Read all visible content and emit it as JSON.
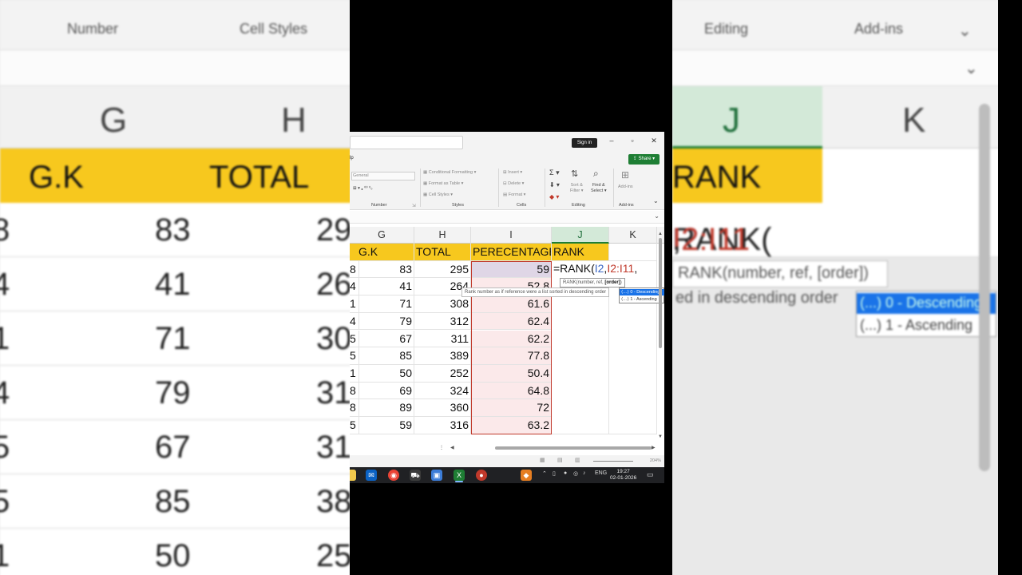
{
  "ribbon": {
    "number_label": "Number",
    "styles_label": "Styles",
    "cells_label": "Cells",
    "editing_label": "Editing",
    "addins_label": "Add-ins",
    "cell_styles": "Cell Styles",
    "conditional_formatting": "Conditional Formatting",
    "format_as_table": "Format as Table",
    "insert": "Insert",
    "delete": "Delete",
    "format": "Format",
    "general": "General",
    "sort_filter": "Sort & Filter",
    "find_select": "Find & Select",
    "addins_btn": "Add-ins",
    "help_tab": "lp",
    "sign_in": "Sign in",
    "share": "Share"
  },
  "columns": [
    "G",
    "H",
    "I",
    "J",
    "K"
  ],
  "zoom_columns": [
    "G",
    "H",
    "J",
    "K"
  ],
  "headers": {
    "g": "G.K",
    "h": "TOTAL",
    "i": "PERECENTAGE",
    "j": "RANK"
  },
  "rows": [
    {
      "f": "8",
      "g": "83",
      "h": "295",
      "i": "59"
    },
    {
      "f": "4",
      "g": "41",
      "h": "264",
      "i": "52.8"
    },
    {
      "f": "1",
      "g": "71",
      "h": "308",
      "i": "61.6"
    },
    {
      "f": "4",
      "g": "79",
      "h": "312",
      "i": "62.4"
    },
    {
      "f": "5",
      "g": "67",
      "h": "311",
      "i": "62.2"
    },
    {
      "f": "5",
      "g": "85",
      "h": "389",
      "i": "77.8"
    },
    {
      "f": "1",
      "g": "50",
      "h": "252",
      "i": "50.4"
    },
    {
      "f": "8",
      "g": "69",
      "h": "324",
      "i": "64.8"
    },
    {
      "f": "8",
      "g": "89",
      "h": "360",
      "i": "72"
    },
    {
      "f": "5",
      "g": "59",
      "h": "316",
      "i": "63.2"
    }
  ],
  "zoom_rows": [
    {
      "f": "8",
      "g": "83",
      "h": "29"
    },
    {
      "f": "4",
      "g": "41",
      "h": "26"
    },
    {
      "f": "1",
      "g": "71",
      "h": "30"
    },
    {
      "f": "4",
      "g": "79",
      "h": "31"
    },
    {
      "f": "5",
      "g": "67",
      "h": "31"
    },
    {
      "f": "5",
      "g": "85",
      "h": "38"
    },
    {
      "f": "1",
      "g": "50",
      "h": "25"
    }
  ],
  "formula": {
    "prefix": "=RANK(",
    "arg1": "I2",
    "sep": ",",
    "arg2": "I2:I11",
    "suffix": ","
  },
  "zoom_formula": {
    "prefix": "RANK(",
    "arg1": "I2",
    "sep": ",",
    "arg2": "I2:I11",
    "suffix": ",",
    "header": "RANK",
    "tooltip": "RANK(number, ref, [order])",
    "desc": "ed in descending order",
    "ac_a": "(...) 0 - Descending",
    "ac_b": "(...) 1 - Ascending"
  },
  "tooltip": {
    "signature_prefix": "RANK(number, ref, ",
    "signature_bold": "[order]",
    "signature_suffix": ")",
    "description": "Rank number as if reference were a list sorted in descending order"
  },
  "autocomplete": {
    "options": [
      "0 - Descending",
      "1 - Ascending"
    ],
    "selected": "0 - Descending"
  },
  "status": {
    "zoom": "204%"
  },
  "taskbar": {
    "time": "19:27",
    "date": "02-01-2026",
    "lang": "ENG"
  },
  "colors": {
    "header_yellow": "#f7c81e",
    "excel_green": "#1e7e34",
    "selection_blue": "#1a73e8",
    "ref_blue": "#3a66c4",
    "ref_red": "#c0392b"
  }
}
